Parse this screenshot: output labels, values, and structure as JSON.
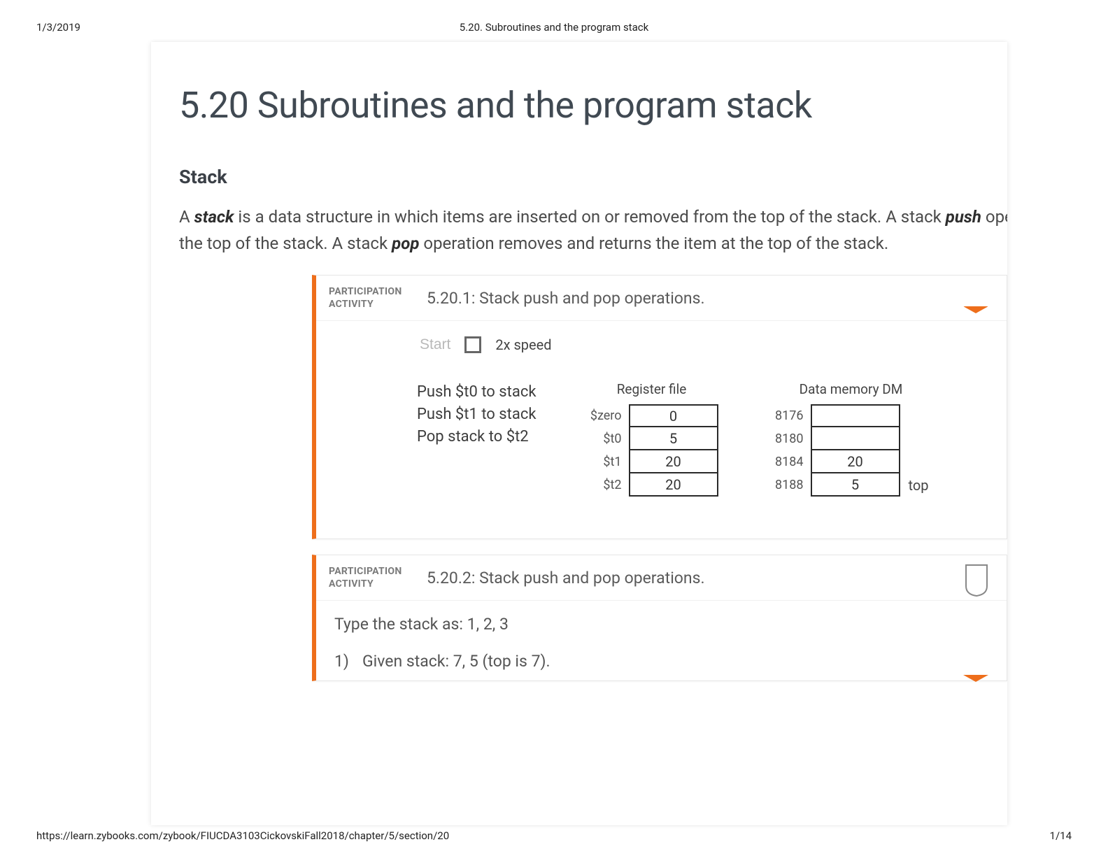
{
  "print": {
    "date": "1/3/2019",
    "doc_title": "5.20. Subroutines and the program stack",
    "url": "https://learn.zybooks.com/zybook/FIUCDA3103CickovskiFall2018/chapter/5/section/20",
    "page_count": "1/14"
  },
  "section": {
    "title": "5.20 Subroutines and the program stack",
    "subhead": "Stack",
    "para_parts": {
      "p1a": "A ",
      "p1b": "stack",
      "p1c": " is a data structure in which items are inserted on or removed from the top of the stack. A stack ",
      "p1d": "push",
      "p1e": " operation inse",
      "p2a": "the top of the stack. A stack ",
      "p2b": "pop",
      "p2c": " operation removes and returns the item at the top of the stack."
    }
  },
  "activity1": {
    "pa_label1": "PARTICIPATION",
    "pa_label2": "ACTIVITY",
    "title": "5.20.1: Stack push and pop operations.",
    "start": "Start",
    "speed": "2x speed",
    "instructions": [
      "Push $t0 to stack",
      "Push $t1 to stack",
      "Pop stack to $t2"
    ],
    "regfile": {
      "title": "Register file",
      "rows": [
        {
          "label": "$zero",
          "value": "0"
        },
        {
          "label": "$t0",
          "value": "5"
        },
        {
          "label": "$t1",
          "value": "20"
        },
        {
          "label": "$t2",
          "value": "20"
        }
      ]
    },
    "dm": {
      "title": "Data memory DM",
      "rows": [
        {
          "label": "8176",
          "value": "",
          "suffix": ""
        },
        {
          "label": "8180",
          "value": "",
          "suffix": ""
        },
        {
          "label": "8184",
          "value": "20",
          "suffix": ""
        },
        {
          "label": "8188",
          "value": "5",
          "suffix": "top"
        }
      ]
    }
  },
  "activity2": {
    "pa_label1": "PARTICIPATION",
    "pa_label2": "ACTIVITY",
    "title": "5.20.2: Stack push and pop operations.",
    "instruction": "Type the stack as: 1, 2, 3",
    "q1_num": "1)",
    "q1_text": "Given stack: 7, 5 (top is 7)."
  }
}
